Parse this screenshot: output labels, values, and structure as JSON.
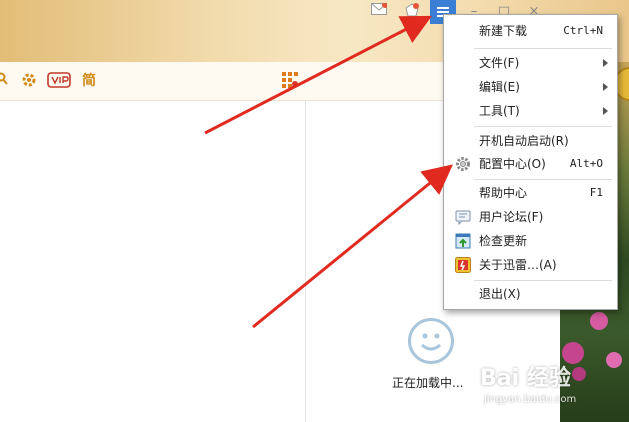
{
  "toolbar": {
    "skin_label": "简"
  },
  "menu": {
    "items": [
      {
        "label": "新建下载",
        "shortcut": "Ctrl+N"
      },
      {
        "label": "文件(F)"
      },
      {
        "label": "编辑(E)"
      },
      {
        "label": "工具(T)"
      },
      {
        "label": "开机自动启动(R)"
      },
      {
        "label": "配置中心(O)",
        "shortcut": "Alt+O"
      },
      {
        "label": "帮助中心",
        "shortcut": "F1"
      },
      {
        "label": "用户论坛(F)"
      },
      {
        "label": "检查更新"
      },
      {
        "label": "关于迅雷…(A)"
      },
      {
        "label": "退出(X)"
      }
    ]
  },
  "status": {
    "loading": "正在加载中..."
  },
  "watermark": {
    "brand": "Bai 经验",
    "url": "jingyan.baidu.com"
  },
  "colors": {
    "accent_blue": "#3a7fd5",
    "arrow_red": "#e02a1f"
  }
}
